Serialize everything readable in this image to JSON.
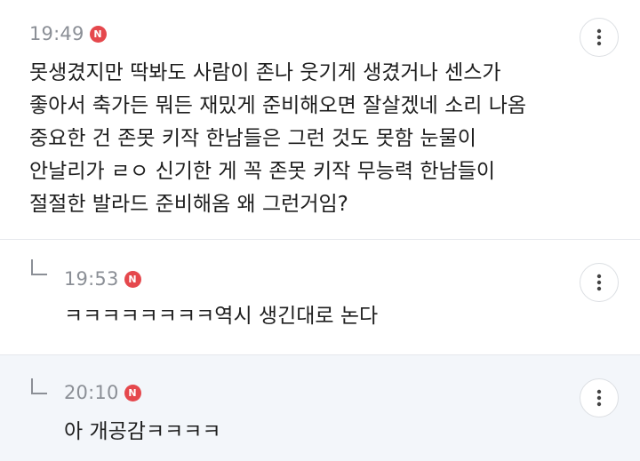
{
  "comments": [
    {
      "time": "19:49",
      "badge": "N",
      "text": "못생겼지만 딱봐도 사람이 존나 웃기게 생겼거나 센스가\n좋아서 축가든 뭐든 재밌게 준비해오면 잘살겠네 소리 나옴\n중요한 건 존못 키작 한남들은 그런 것도 못함 눈물이\n안날리가 ㄹㅇ 신기한 게 꼭 존못 키작 무능력 한남들이\n절절한 발라드 준비해옴 왜 그런거임?"
    },
    {
      "time": "19:53",
      "badge": "N",
      "text": "ㅋㅋㅋㅋㅋㅋㅋㅋ역시 생긴대로 논다"
    },
    {
      "time": "20:10",
      "badge": "N",
      "text": "아 개공감ㅋㅋㅋㅋ"
    }
  ],
  "icons": {
    "more": "more-vertical-icon",
    "reply": "reply-arrow-icon"
  },
  "colors": {
    "badge": "#e5484d",
    "reply_highlight_bg": "#f3f6fa",
    "timestamp": "#8b8f96"
  }
}
